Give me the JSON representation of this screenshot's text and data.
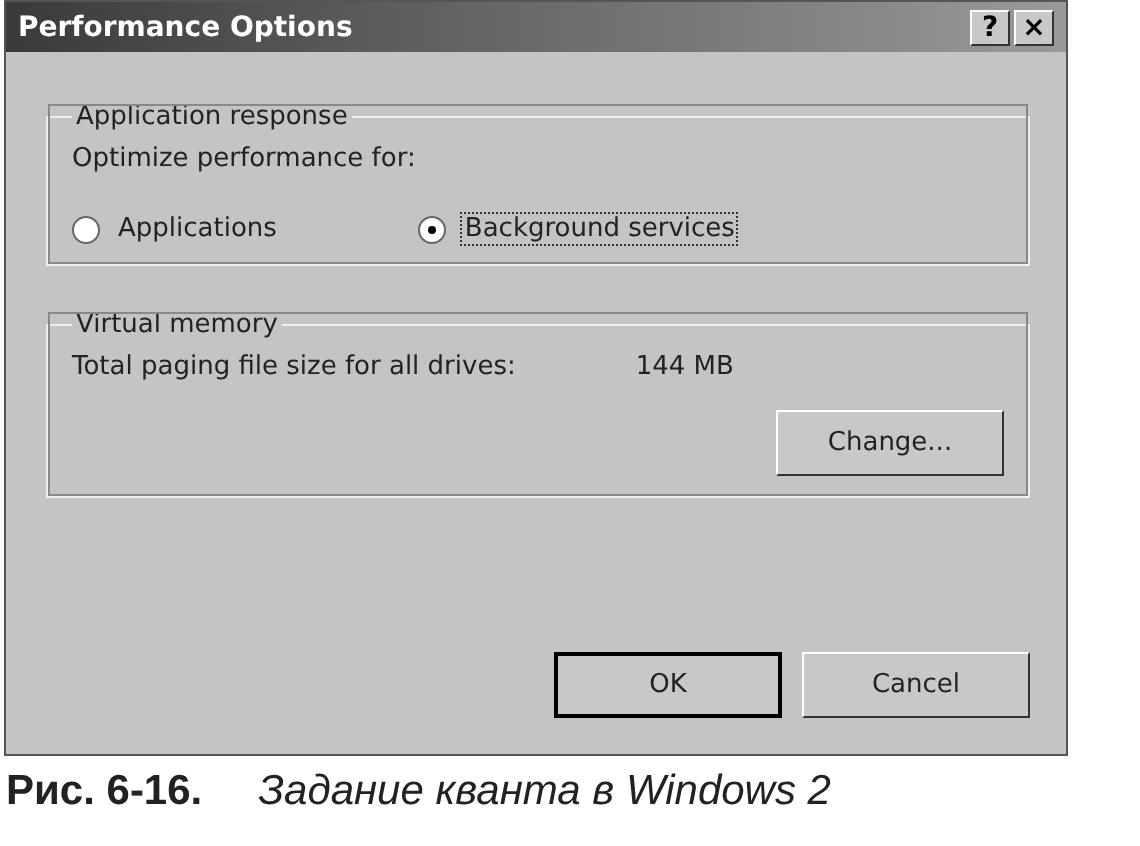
{
  "window": {
    "title": "Performance Options",
    "title_buttons": [
      "?",
      "×"
    ]
  },
  "application_response": {
    "title": "Application response",
    "prompt": "Optimize performance for:",
    "options": [
      {
        "label": "Applications",
        "selected": false
      },
      {
        "label": "Background services",
        "selected": true
      }
    ]
  },
  "virtual_memory": {
    "title": "Virtual memory",
    "label": "Total paging file size for all drives:",
    "value": "144 MB",
    "button": "Change..."
  },
  "buttons": [
    "OK",
    "Cancel"
  ],
  "caption": {
    "number": "Рис. 6-16.",
    "text": "Задание кванта в Windows 2"
  }
}
